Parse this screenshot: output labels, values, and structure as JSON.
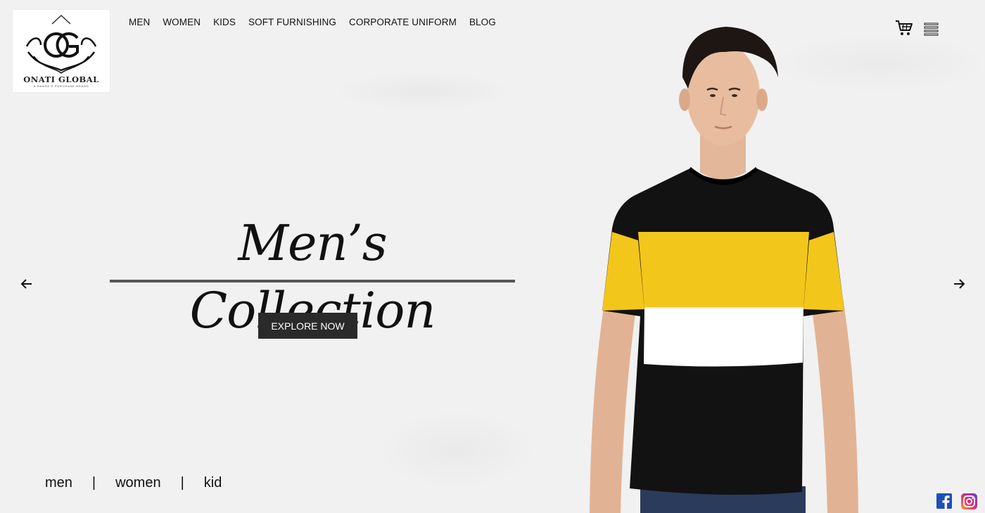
{
  "brand": {
    "name": "ONATI GLOBAL",
    "tagline": "A RANGE'S PURCHASE BRAND",
    "monogram": "OG"
  },
  "nav": {
    "items": [
      {
        "label": "MEN"
      },
      {
        "label": "WOMEN"
      },
      {
        "label": "KIDS"
      },
      {
        "label": "SOFT FURNISHING"
      },
      {
        "label": "CORPORATE UNIFORM"
      },
      {
        "label": "BLOG"
      }
    ]
  },
  "header_icons": {
    "cart": "cart-icon",
    "menu": "menu-icon"
  },
  "hero": {
    "title": "Men’s Collection",
    "cta_label": "EXPLORE NOW"
  },
  "slider": {
    "prev": "arrow-left-icon",
    "next": "arrow-right-icon"
  },
  "categories": {
    "links": [
      {
        "label": "men"
      },
      {
        "label": "women"
      },
      {
        "label": "kid"
      }
    ],
    "separator": "|"
  },
  "social": {
    "facebook": "facebook-icon",
    "instagram": "instagram-icon"
  },
  "colors": {
    "background": "#f1f1f1",
    "button": "#2a2a2a",
    "rule": "#555555",
    "tee_yellow": "#f3c61b",
    "tee_black": "#121212",
    "facebook": "#1877f2"
  }
}
